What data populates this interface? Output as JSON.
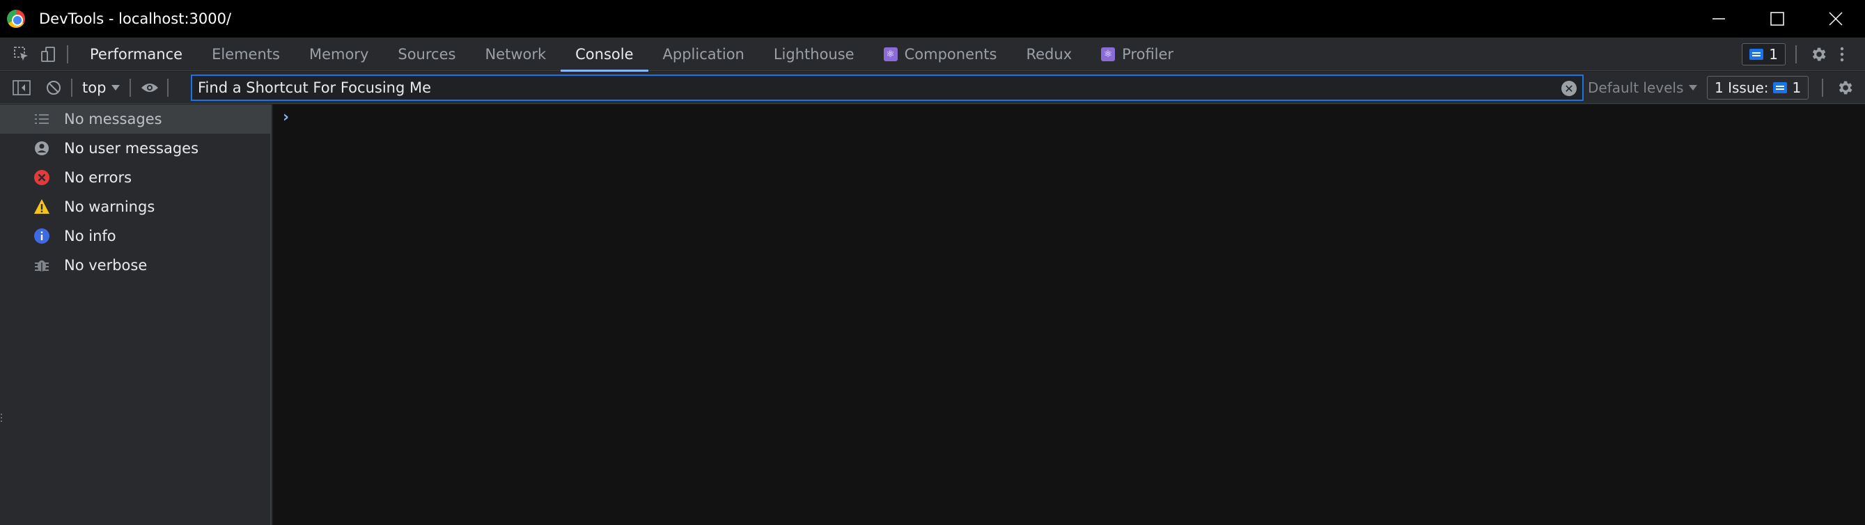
{
  "window": {
    "title": "DevTools - localhost:3000/",
    "controls": [
      "minimize-icon",
      "maximize-icon",
      "close-icon"
    ]
  },
  "tabs": [
    {
      "label": "Performance",
      "state": "hover"
    },
    {
      "label": "Elements"
    },
    {
      "label": "Memory"
    },
    {
      "label": "Sources"
    },
    {
      "label": "Network"
    },
    {
      "label": "Console",
      "state": "selected"
    },
    {
      "label": "Application"
    },
    {
      "label": "Lighthouse"
    },
    {
      "label": "Components",
      "icon": "react-icon"
    },
    {
      "label": "Redux"
    },
    {
      "label": "Profiler",
      "icon": "react-icon"
    }
  ],
  "tabbar_right": {
    "issues_count": "1"
  },
  "console_toolbar": {
    "context": "top",
    "filter_value": "Find a Shortcut For Focusing Me",
    "levels_label": "Default levels",
    "issues_label": "1 Issue:",
    "issues_count": "1"
  },
  "sidebar": {
    "items": [
      {
        "label": "No messages",
        "icon": "list-icon"
      },
      {
        "label": "No user messages",
        "icon": "user-icon"
      },
      {
        "label": "No errors",
        "icon": "error-icon"
      },
      {
        "label": "No warnings",
        "icon": "warning-icon"
      },
      {
        "label": "No info",
        "icon": "info-icon"
      },
      {
        "label": "No verbose",
        "icon": "bug-icon"
      }
    ]
  },
  "colors": {
    "accent": "#1a73e8",
    "error": "#e03c3c",
    "warning": "#f5c518",
    "info": "#3e6ae1",
    "react": "#8b6cd6"
  }
}
